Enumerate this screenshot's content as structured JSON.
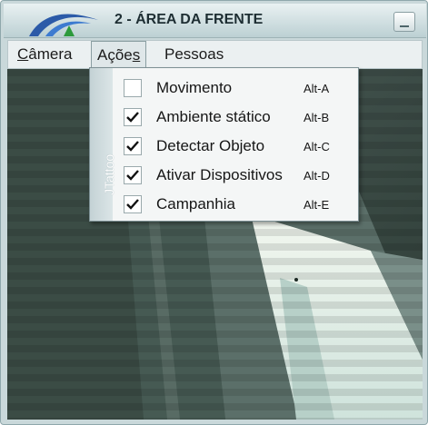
{
  "window": {
    "title": "2 - ÁREA DA FRENTE",
    "logo": "brand-swoosh-logo",
    "minimize": "minimize-icon"
  },
  "menubar": {
    "camera_underline": "C",
    "camera_rest": "âmera",
    "acoes_prefix": "Açõe",
    "acoes_underline": "s",
    "pessoas": "Pessoas"
  },
  "dropdown": {
    "side_label": "JTattoo",
    "items": [
      {
        "label": "Movimento",
        "shortcut": "Alt-A",
        "checked": false
      },
      {
        "label": "Ambiente stático",
        "shortcut": "Alt-B",
        "checked": true
      },
      {
        "label": "Detectar Objeto",
        "shortcut": "Alt-C",
        "checked": true
      },
      {
        "label": "Ativar Dispositivos",
        "shortcut": "Alt-D",
        "checked": true
      },
      {
        "label": "Campanhia",
        "shortcut": "Alt-E",
        "checked": true
      }
    ]
  },
  "colors": {
    "logo_blue": "#2b5aa8",
    "logo_green": "#2c9a3c",
    "frame": "#c9d8da"
  }
}
